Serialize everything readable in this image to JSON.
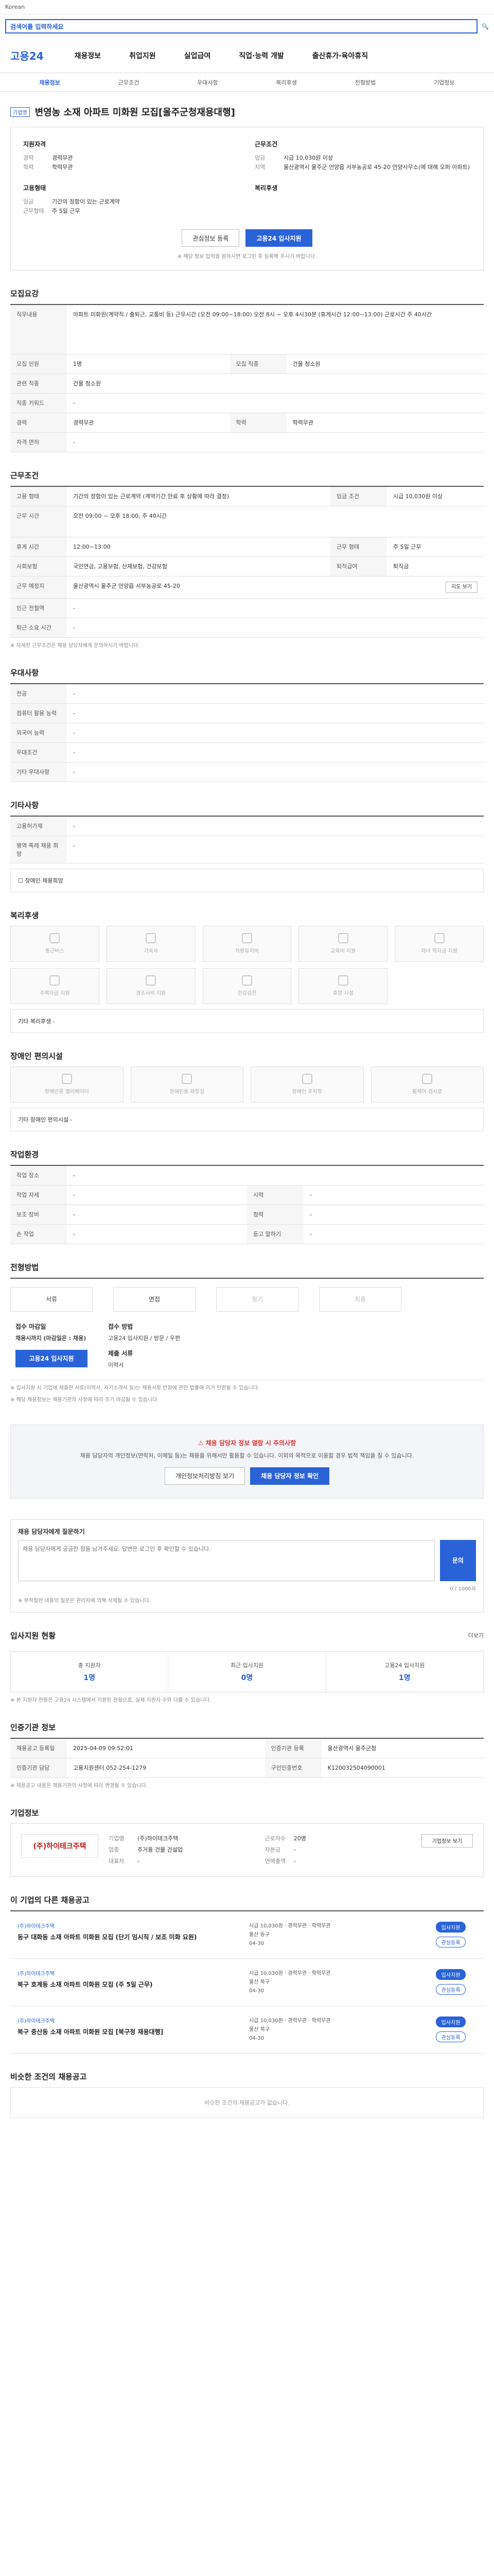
{
  "topbar": {
    "util": "Korean"
  },
  "search": {
    "placeholder": "검색어를 입력하세요"
  },
  "header": {
    "logo": "고용24",
    "menu": [
      "채용정보",
      "취업지원",
      "실업급여",
      "직업·능력 개발",
      "출산휴가·육아휴직"
    ]
  },
  "tabs": [
    "채용정보",
    "근무조건",
    "우대사항",
    "복리후생",
    "전형방법",
    "기업정보"
  ],
  "job": {
    "tag": "기업명",
    "title": "변영농 소재 아파트 미화원 모집[울주군청재용대행]",
    "summary_left_title": "지원자격",
    "summary_left": [
      {
        "k": "경력",
        "v": "경력무관"
      },
      {
        "k": "학력",
        "v": "학력무관"
      }
    ],
    "summary_left2_title": "고용형태",
    "summary_left2": [
      {
        "k": "임금",
        "v": "기간의 정함이 있는 근로계약"
      },
      {
        "k": "근무형태",
        "v": "주 5일 근무"
      }
    ],
    "summary_right_title": "근무조건",
    "summary_right": [
      {
        "k": "임금",
        "v": "시급 10,030원 이상"
      },
      {
        "k": "지역",
        "v": "울산광역시 울주군 언양읍 서부농공로 45-20 언양사무소(에 대해 오퍼 아파트)"
      }
    ],
    "summary_right2_title": "복리후생",
    "buttons": {
      "scrap": "관심정보 등록",
      "apply": "고용24 입사지원"
    },
    "note": "※ 해당 정보 입력을 원하시면 로그인 후 등록해 주시기 바랍니다."
  },
  "recruit": {
    "title": "모집요강",
    "rows": [
      {
        "k": "직무내용",
        "v": "아파트 미화원(계약직 / 출퇴근, 교통비 등) 근무시간 (오전 09:00~18:00) 오전 8시 ~ 오후 4시30분 (휴게시간 12:00~13:00) 근로시간 주 40시간"
      },
      {
        "k": "모집 직종",
        "v": "건물 청소원"
      },
      {
        "k": "모집 인원",
        "v": "1명"
      },
      {
        "k": "관련 직종",
        "v": "건물 청소원"
      },
      {
        "k": "직종 키워드",
        "v": "-"
      },
      {
        "k": "경력",
        "v": "경력무관"
      },
      {
        "k": "학력",
        "v": "학력무관"
      },
      {
        "k": "자격 면허",
        "v": "-"
      }
    ]
  },
  "conditions": {
    "title": "근무조건",
    "rows": [
      {
        "k": "고용 형태",
        "v": "기간의 정함이 있는 근로계약 (계약기간 만료 후 상황에 따라 결정)"
      },
      {
        "k": "임금 조건",
        "v": "시급 10,030원 이상"
      },
      {
        "k": "근무 시간",
        "v": "오전 09:00 ~ 오후 18:00, 주 40시간"
      },
      {
        "k": "휴게 시간",
        "v": "12:00~13:00"
      },
      {
        "k": "근무 형태",
        "v": "주 5일 근무"
      },
      {
        "k": "사회보험",
        "v": "국민연금, 고용보험, 산재보험, 건강보험"
      },
      {
        "k": "퇴직급여",
        "v": "퇴직금"
      },
      {
        "k": "근무 예정지",
        "v": "울산광역시 울주군 언양읍 서부농공로 45-20"
      },
      {
        "k": "인근 전철역",
        "v": "-"
      },
      {
        "k": "퇴근 소요 시간",
        "v": "-"
      }
    ],
    "map_button": "지도 보기",
    "note": "※ 자세한 근무조건은 채용 담당자에게 문의하시기 바랍니다."
  },
  "preference": {
    "title": "우대사항",
    "rows": [
      {
        "k": "전공",
        "v": "-"
      },
      {
        "k": "컴퓨터 활용 능력",
        "v": "-"
      },
      {
        "k": "외국어 능력",
        "v": "-"
      },
      {
        "k": "우대조건",
        "v": "-"
      },
      {
        "k": "기타 우대사항",
        "v": "-"
      }
    ]
  },
  "etc": {
    "title": "기타사항",
    "rows": [
      {
        "k": "고용허가제",
        "v": "-"
      },
      {
        "k": "병역 특례 채용 희망",
        "v": "-"
      }
    ],
    "extra": "장애인 채용희망"
  },
  "welfare": {
    "title": "복리후생",
    "icons": [
      "통근버스",
      "기숙사",
      "차량유지비",
      "교육비 지원",
      "자녀 학자금 지원",
      "주택자금 지원",
      "경조사비 지원",
      "건강검진",
      "휴양 시설"
    ],
    "other_label": "기타 복리후생",
    "other_value": "-"
  },
  "disability": {
    "title": "장애인 편의시설",
    "icons": [
      "장애인용 엘리베이터",
      "장애인용 화장실",
      "장애인 주차장",
      "휠체어 경사로"
    ],
    "other_label": "기타 장애인 편의시설",
    "other_value": "-"
  },
  "env": {
    "title": "작업환경",
    "rows": [
      {
        "k": "작업 장소",
        "v": "-"
      },
      {
        "k": "작업 자세",
        "v": "-"
      },
      {
        "k": "보조 장비",
        "v": "-"
      },
      {
        "k": "시력",
        "v": "-"
      },
      {
        "k": "청력",
        "v": "-"
      },
      {
        "k": "손 작업",
        "v": "-"
      },
      {
        "k": "양손 작업",
        "v": "-"
      },
      {
        "k": "듣고 말하기",
        "v": "-"
      }
    ]
  },
  "selection": {
    "title": "전형방법",
    "steps": [
      "서류",
      "면접",
      "필기",
      "최종"
    ],
    "apply_title": "접수 마감일",
    "apply_deadline": "채용시까지 (마감일은 : 채용)",
    "apply_method_title": "접수 방법",
    "apply_method": "고용24 입사지원 / 방문 / 우편",
    "docs_title": "제출 서류",
    "docs": "이력서",
    "apply_button": "고용24 입사지원",
    "note1": "※ 입사지원 시 기업에 제출한 서류(이력서, 자기소개서 등)는 채용서류 반환에 관한 법률에 의거 반환될 수 있습니다.",
    "note2": "※ 해당 채용정보는 채용기관의 사정에 따라 조기 마감될 수 있습니다."
  },
  "warn": {
    "title": "채용 담당자 정보 열람 시 주의사항",
    "text": "채용 담당자의 개인정보(연락처, 이메일 등)는 채용을 위해서만 활용할 수 있습니다. 이외의 목적으로 이용할 경우 법적 책임을 질 수 있습니다.",
    "btn1": "개인정보처리방침 보기",
    "btn2": "채용 담당자 정보 확인"
  },
  "qa": {
    "title": "채용 담당자에게 질문하기",
    "placeholder": "채용 담당자에게 궁금한 점을 남겨주세요. 답변은 로그인 후 확인할 수 있습니다.",
    "send": "문의",
    "count": "0 / 1000자",
    "note": "※ 부적절한 내용의 질문은 관리자에 의해 삭제될 수 있습니다."
  },
  "stats": {
    "title": "입사지원 현황",
    "more": "더보기",
    "items": [
      {
        "label": "총 지원자",
        "value": "1명"
      },
      {
        "label": "최근 입사지원",
        "value": "0명"
      },
      {
        "label": "고용24 입사지원",
        "value": "1명"
      }
    ],
    "note": "※ 본 지원자 현황은 고용24 시스템에서 지원된 현황으로, 실제 지원자 수와 다를 수 있습니다."
  },
  "reg": {
    "title": "인증기관 정보",
    "rows": [
      {
        "k": "채용공고 등록일",
        "v": "2025-04-09 09:52:01"
      },
      {
        "k": "인증기관 등록",
        "v": "울산광역시 울주군청"
      },
      {
        "k": "인증기관 담당",
        "v": "고용지원센터 052-254-1279"
      },
      {
        "k": "구인인증번호",
        "v": "K120032504090001"
      }
    ],
    "note": "※ 채용공고 내용은 채용기관의 사정에 따라 변경될 수 있습니다."
  },
  "company": {
    "title": "기업정보",
    "logo": "(주)하이테크주택",
    "rows": [
      {
        "k": "기업명",
        "v": "(주)하이테크주택"
      },
      {
        "k": "업종",
        "v": "주거용 건물 건설업"
      },
      {
        "k": "대표자",
        "v": "-"
      },
      {
        "k": "근로자수",
        "v": "20명"
      },
      {
        "k": "자본금",
        "v": "-"
      },
      {
        "k": "연매출액",
        "v": "-"
      }
    ],
    "btn": "기업정보 보기"
  },
  "others": {
    "title": "이 기업의 다른 채용공고",
    "items": [
      {
        "co": "(주)하이테크주택",
        "t": "동구 대화동 소재 아파트 미화원 모집 (단기 임시직 / 보조 미화 요원)",
        "cond": "시급 10,030원 · 경력무관 · 학력무관",
        "loc": "울산 동구",
        "d": "04-30"
      },
      {
        "co": "(주)하이테크주택",
        "t": "북구 호계동 소재 아파트 미화원 모집 (주 5일 근무)",
        "cond": "시급 10,030원 · 경력무관 · 학력무관",
        "loc": "울산 북구",
        "d": "04-30"
      },
      {
        "co": "(주)하이테크주택",
        "t": "북구 중산동 소재 아파트 미화원 모집 [북구청 재용대행]",
        "cond": "시급 10,030원 · 경력무관 · 학력무관",
        "loc": "울산 북구",
        "d": "04-30"
      }
    ],
    "apply": "입사지원",
    "scrap": "관심등록"
  },
  "similar": {
    "title": "비슷한 조건의 채용공고",
    "empty": "비슷한 조건의 채용공고가 없습니다."
  }
}
